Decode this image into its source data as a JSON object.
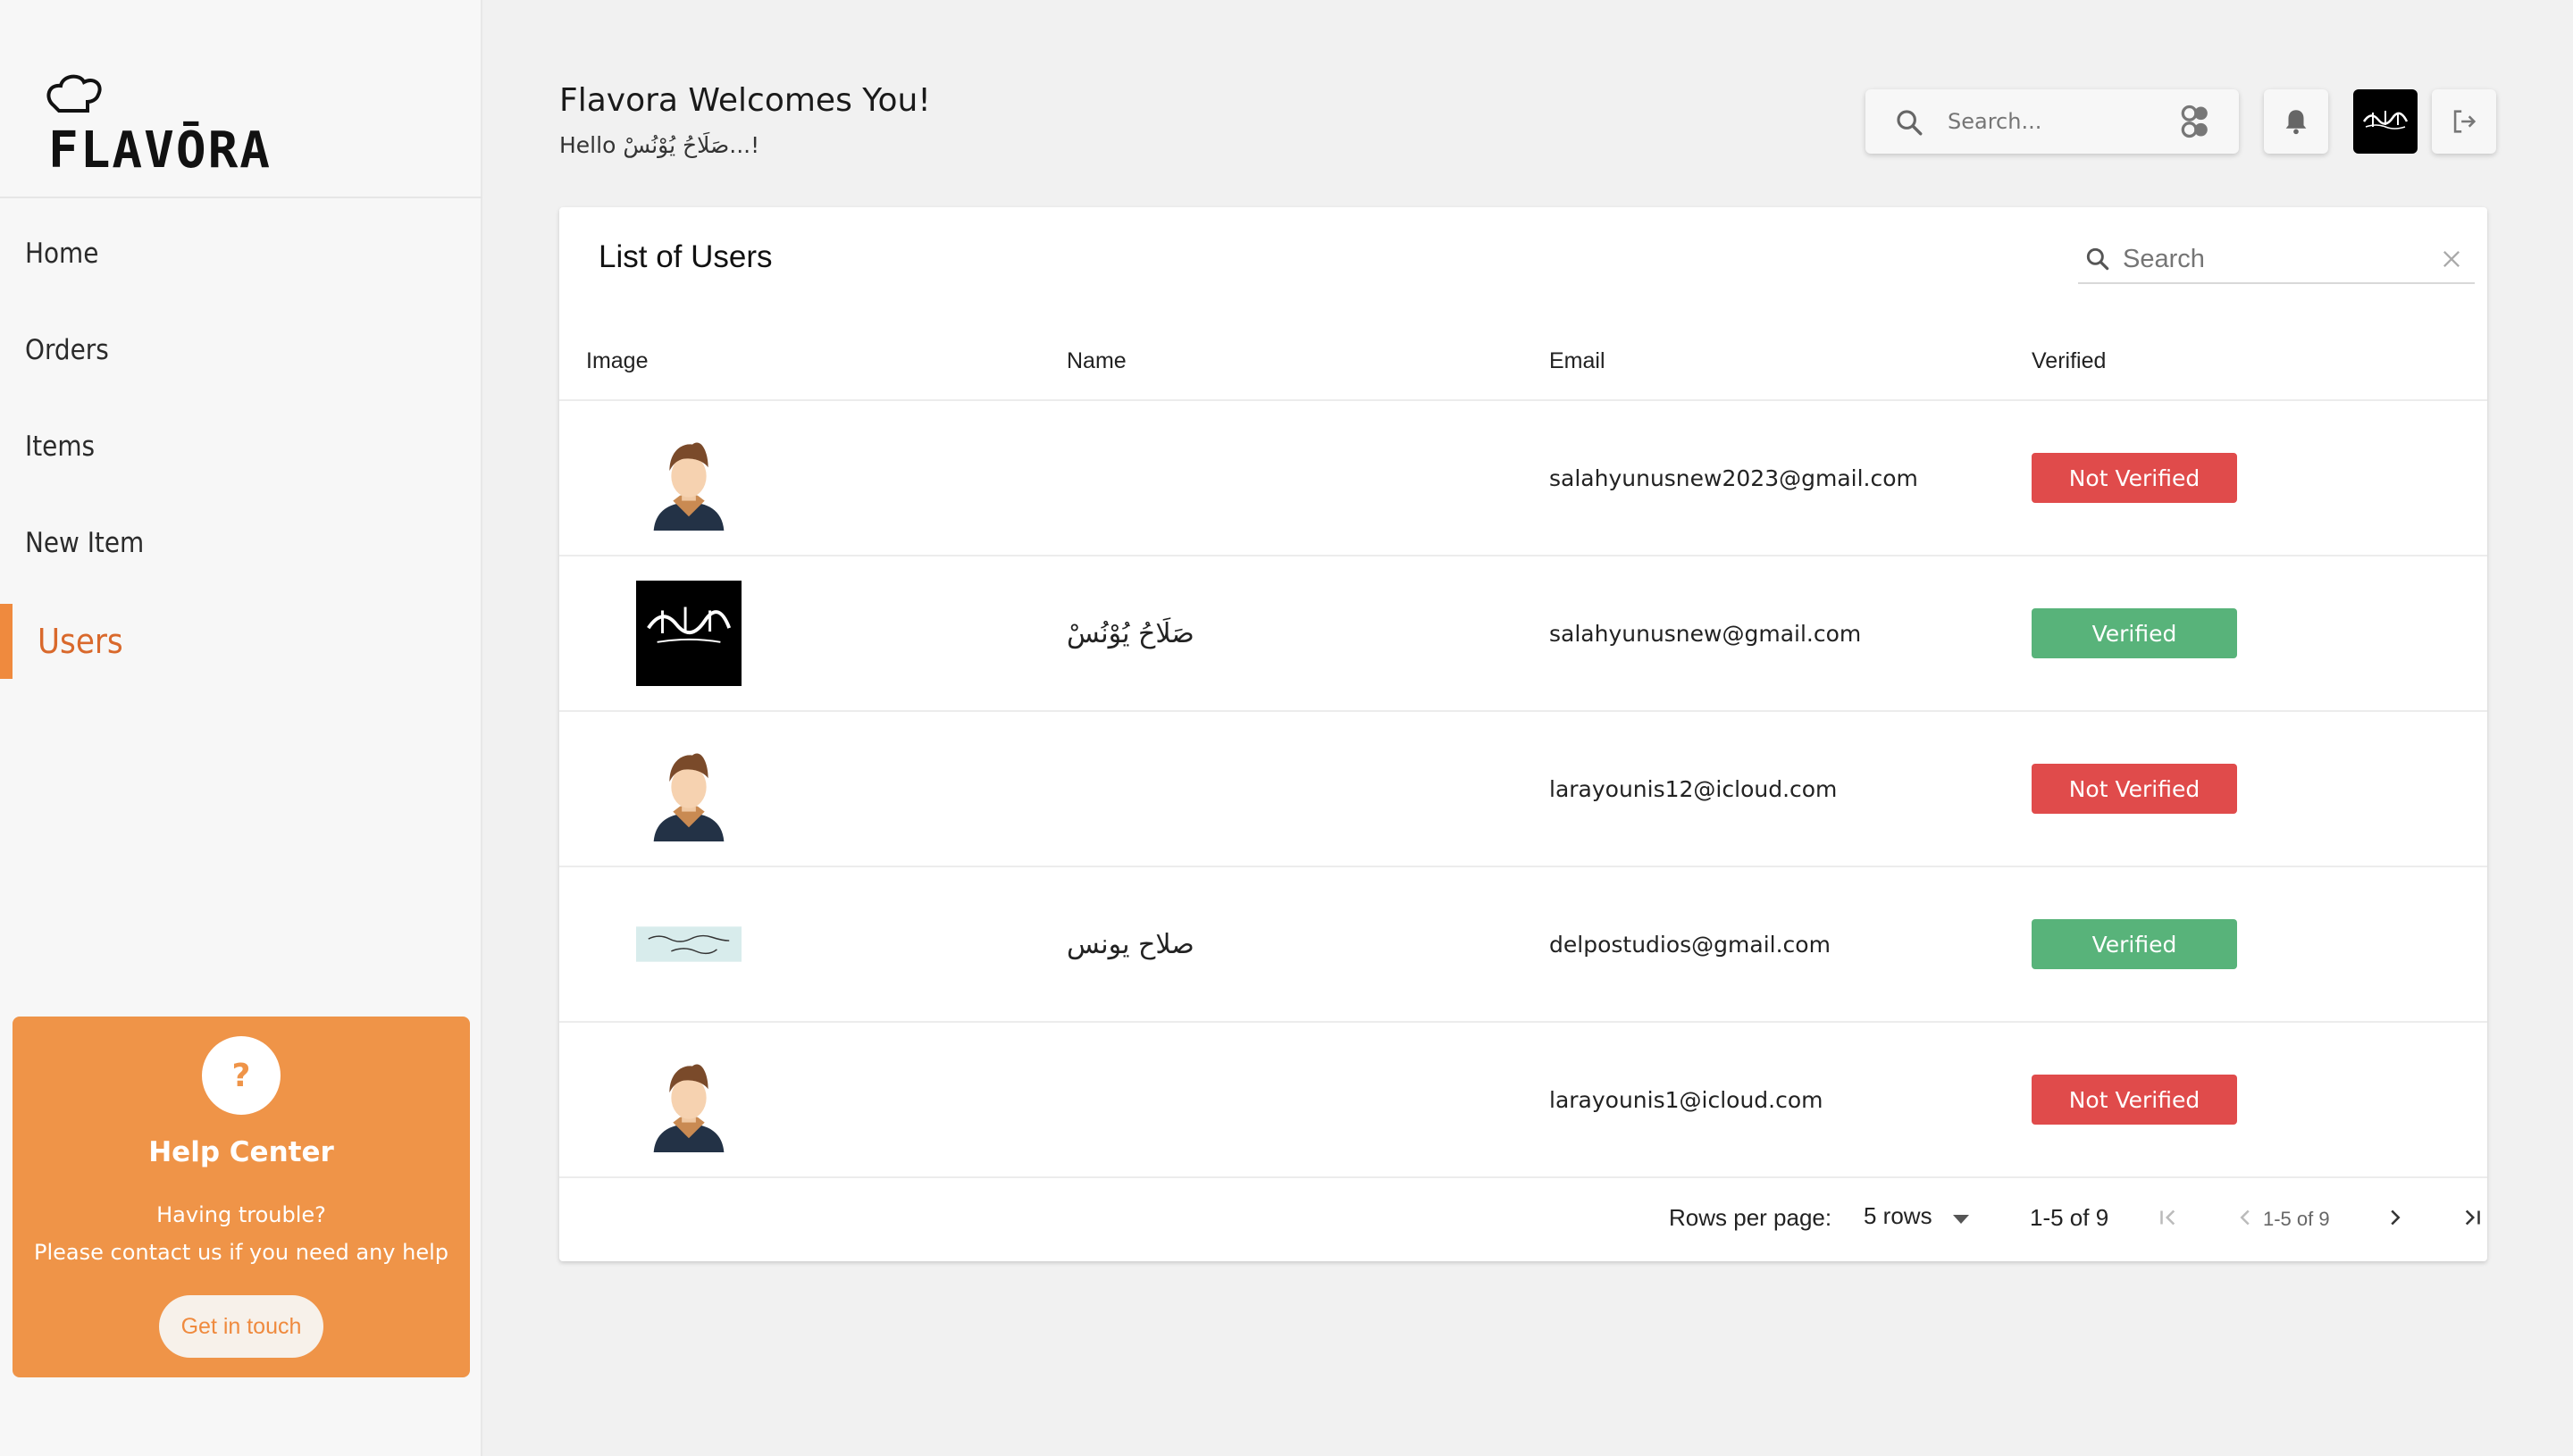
{
  "sidebar": {
    "logo_text": "FLAVŌRA",
    "items": [
      {
        "label": "Home"
      },
      {
        "label": "Orders"
      },
      {
        "label": "Items"
      },
      {
        "label": "New Item"
      },
      {
        "label": "Users"
      }
    ],
    "active": "Users",
    "help": {
      "icon": "?",
      "title": "Help Center",
      "line1": "Having trouble?",
      "line2": "Please contact us if you need any help",
      "button": "Get in touch"
    }
  },
  "header": {
    "welcome": "Flavora Welcomes You!",
    "hello": "Hello صَلَاحُ يُوْنُسْ...!",
    "search_placeholder": "Search..."
  },
  "users_card": {
    "title": "List of Users",
    "search_placeholder": "Search",
    "columns": [
      "Image",
      "Name",
      "Email",
      "Verified"
    ],
    "rows": [
      {
        "image": "default-avatar",
        "name": "",
        "email": "salahyunusnew2023@gmail.com",
        "verified": "Not Verified"
      },
      {
        "image": "black-flag",
        "name": "صَلَاحُ يُوْنُسْ",
        "email": "salahyunusnew@gmail.com",
        "verified": "Verified"
      },
      {
        "image": "default-avatar",
        "name": "",
        "email": "larayounis12@icloud.com",
        "verified": "Not Verified"
      },
      {
        "image": "calligraphy-banner",
        "name": "صلاح يونس",
        "email": "delpostudios@gmail.com",
        "verified": "Verified"
      },
      {
        "image": "default-avatar",
        "name": "",
        "email": "larayounis1@icloud.com",
        "verified": "Not Verified"
      }
    ],
    "pagination": {
      "rows_per_page_label": "Rows per page:",
      "rows_per_page_value": "5 rows",
      "range": "1-5 of 9",
      "range_small": "1-5 of 9"
    }
  },
  "colors": {
    "accent": "#ef8a3e",
    "not_verified": "#e04b4b",
    "verified": "#58b37a"
  }
}
